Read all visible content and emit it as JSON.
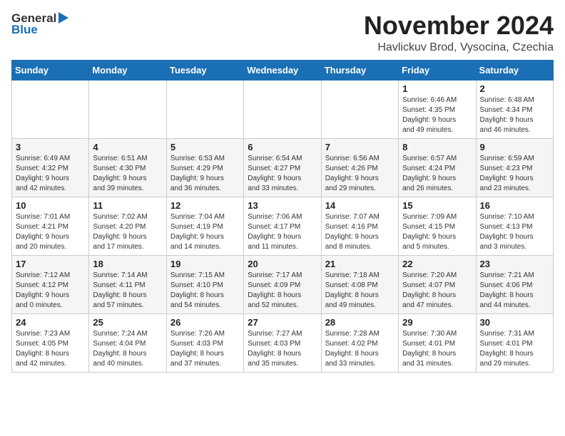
{
  "header": {
    "logo_general": "General",
    "logo_blue": "Blue",
    "month_title": "November 2024",
    "location": "Havlickuv Brod, Vysocina, Czechia"
  },
  "weekdays": [
    "Sunday",
    "Monday",
    "Tuesday",
    "Wednesday",
    "Thursday",
    "Friday",
    "Saturday"
  ],
  "weeks": [
    [
      {
        "day": "",
        "info": ""
      },
      {
        "day": "",
        "info": ""
      },
      {
        "day": "",
        "info": ""
      },
      {
        "day": "",
        "info": ""
      },
      {
        "day": "",
        "info": ""
      },
      {
        "day": "1",
        "info": "Sunrise: 6:46 AM\nSunset: 4:35 PM\nDaylight: 9 hours\nand 49 minutes."
      },
      {
        "day": "2",
        "info": "Sunrise: 6:48 AM\nSunset: 4:34 PM\nDaylight: 9 hours\nand 46 minutes."
      }
    ],
    [
      {
        "day": "3",
        "info": "Sunrise: 6:49 AM\nSunset: 4:32 PM\nDaylight: 9 hours\nand 42 minutes."
      },
      {
        "day": "4",
        "info": "Sunrise: 6:51 AM\nSunset: 4:30 PM\nDaylight: 9 hours\nand 39 minutes."
      },
      {
        "day": "5",
        "info": "Sunrise: 6:53 AM\nSunset: 4:29 PM\nDaylight: 9 hours\nand 36 minutes."
      },
      {
        "day": "6",
        "info": "Sunrise: 6:54 AM\nSunset: 4:27 PM\nDaylight: 9 hours\nand 33 minutes."
      },
      {
        "day": "7",
        "info": "Sunrise: 6:56 AM\nSunset: 4:26 PM\nDaylight: 9 hours\nand 29 minutes."
      },
      {
        "day": "8",
        "info": "Sunrise: 6:57 AM\nSunset: 4:24 PM\nDaylight: 9 hours\nand 26 minutes."
      },
      {
        "day": "9",
        "info": "Sunrise: 6:59 AM\nSunset: 4:23 PM\nDaylight: 9 hours\nand 23 minutes."
      }
    ],
    [
      {
        "day": "10",
        "info": "Sunrise: 7:01 AM\nSunset: 4:21 PM\nDaylight: 9 hours\nand 20 minutes."
      },
      {
        "day": "11",
        "info": "Sunrise: 7:02 AM\nSunset: 4:20 PM\nDaylight: 9 hours\nand 17 minutes."
      },
      {
        "day": "12",
        "info": "Sunrise: 7:04 AM\nSunset: 4:19 PM\nDaylight: 9 hours\nand 14 minutes."
      },
      {
        "day": "13",
        "info": "Sunrise: 7:06 AM\nSunset: 4:17 PM\nDaylight: 9 hours\nand 11 minutes."
      },
      {
        "day": "14",
        "info": "Sunrise: 7:07 AM\nSunset: 4:16 PM\nDaylight: 9 hours\nand 8 minutes."
      },
      {
        "day": "15",
        "info": "Sunrise: 7:09 AM\nSunset: 4:15 PM\nDaylight: 9 hours\nand 5 minutes."
      },
      {
        "day": "16",
        "info": "Sunrise: 7:10 AM\nSunset: 4:13 PM\nDaylight: 9 hours\nand 3 minutes."
      }
    ],
    [
      {
        "day": "17",
        "info": "Sunrise: 7:12 AM\nSunset: 4:12 PM\nDaylight: 9 hours\nand 0 minutes."
      },
      {
        "day": "18",
        "info": "Sunrise: 7:14 AM\nSunset: 4:11 PM\nDaylight: 8 hours\nand 57 minutes."
      },
      {
        "day": "19",
        "info": "Sunrise: 7:15 AM\nSunset: 4:10 PM\nDaylight: 8 hours\nand 54 minutes."
      },
      {
        "day": "20",
        "info": "Sunrise: 7:17 AM\nSunset: 4:09 PM\nDaylight: 8 hours\nand 52 minutes."
      },
      {
        "day": "21",
        "info": "Sunrise: 7:18 AM\nSunset: 4:08 PM\nDaylight: 8 hours\nand 49 minutes."
      },
      {
        "day": "22",
        "info": "Sunrise: 7:20 AM\nSunset: 4:07 PM\nDaylight: 8 hours\nand 47 minutes."
      },
      {
        "day": "23",
        "info": "Sunrise: 7:21 AM\nSunset: 4:06 PM\nDaylight: 8 hours\nand 44 minutes."
      }
    ],
    [
      {
        "day": "24",
        "info": "Sunrise: 7:23 AM\nSunset: 4:05 PM\nDaylight: 8 hours\nand 42 minutes."
      },
      {
        "day": "25",
        "info": "Sunrise: 7:24 AM\nSunset: 4:04 PM\nDaylight: 8 hours\nand 40 minutes."
      },
      {
        "day": "26",
        "info": "Sunrise: 7:26 AM\nSunset: 4:03 PM\nDaylight: 8 hours\nand 37 minutes."
      },
      {
        "day": "27",
        "info": "Sunrise: 7:27 AM\nSunset: 4:03 PM\nDaylight: 8 hours\nand 35 minutes."
      },
      {
        "day": "28",
        "info": "Sunrise: 7:28 AM\nSunset: 4:02 PM\nDaylight: 8 hours\nand 33 minutes."
      },
      {
        "day": "29",
        "info": "Sunrise: 7:30 AM\nSunset: 4:01 PM\nDaylight: 8 hours\nand 31 minutes."
      },
      {
        "day": "30",
        "info": "Sunrise: 7:31 AM\nSunset: 4:01 PM\nDaylight: 8 hours\nand 29 minutes."
      }
    ]
  ]
}
